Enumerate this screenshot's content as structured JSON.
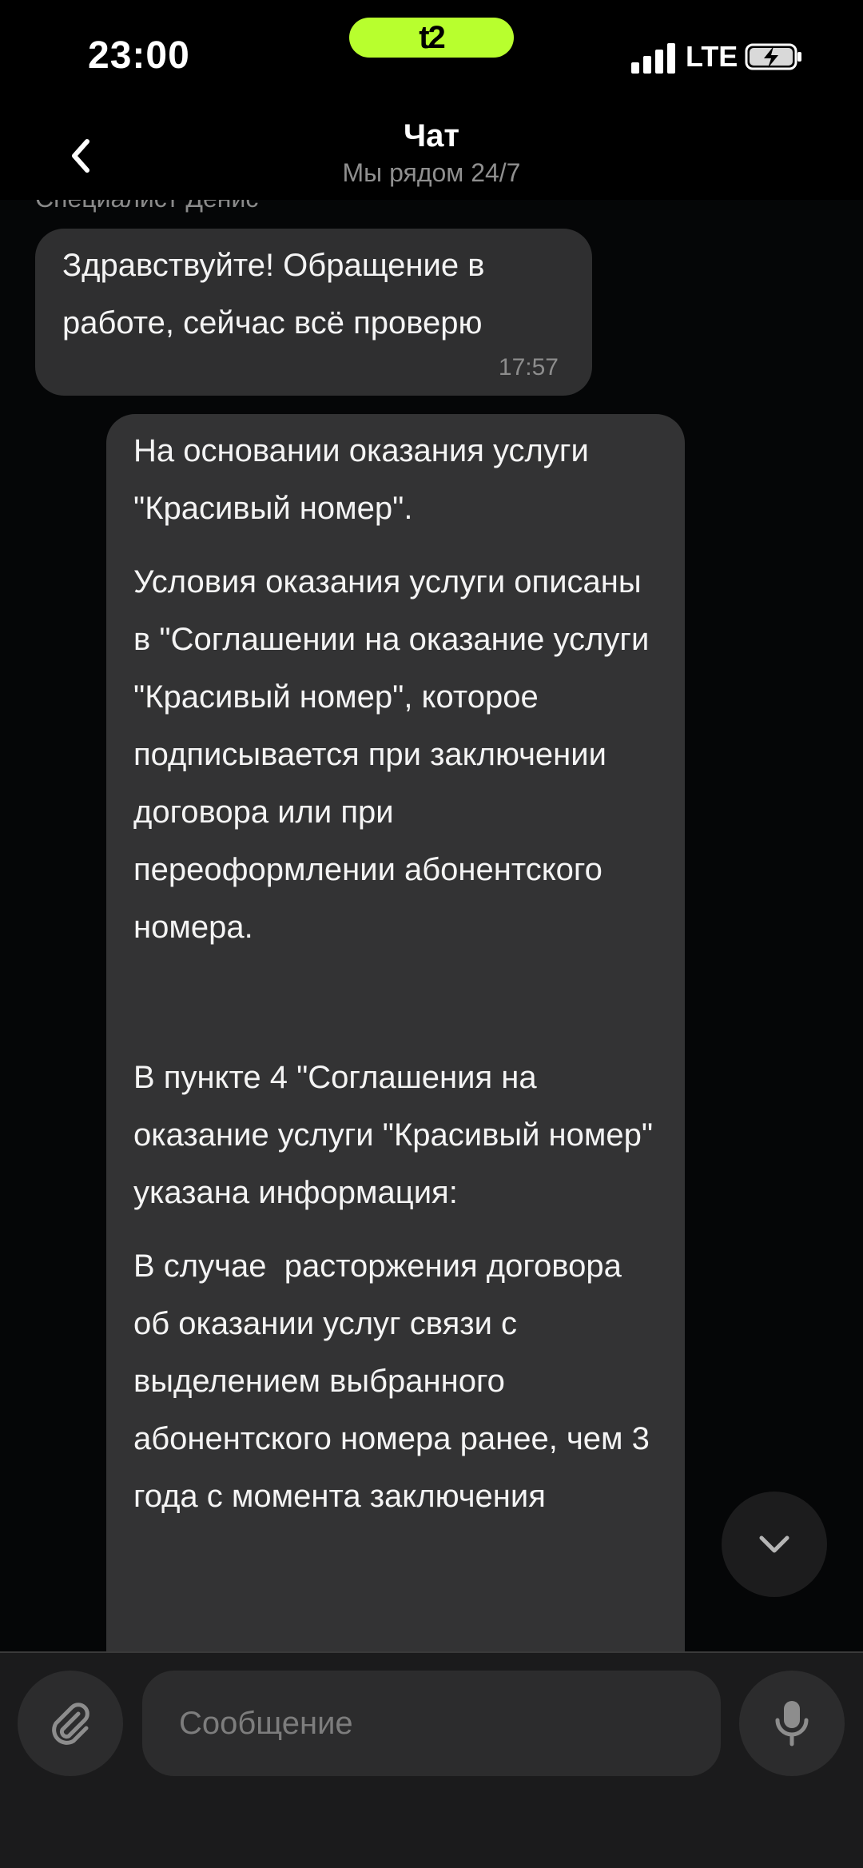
{
  "status_bar": {
    "time": "23:00",
    "carrier": "t2",
    "network": "LTE"
  },
  "header": {
    "title": "Чат",
    "subtitle": "Мы рядом 24/7"
  },
  "messages": [
    {
      "sender": "Специалист Денис",
      "text": "Здравствуйте! Обращение в работе, сейчас всё проверю",
      "time": "17:57"
    },
    {
      "paragraphs": [
        "На основании оказания услуги \"Красивый номер\".",
        "Условия оказания услуги описаны в \"Соглашении на оказание услуги \"Красивый номер\", которое подписывается при заключении договора или при переоформлении абонентского номера.",
        "В пункте 4 \"Соглашения на оказание услуги \"Красивый номер\" указана информация:",
        "В случае  расторжения договора об оказании услуг связи с выделением выбранного  абонентского номера ранее, чем 3 года с момента заключения"
      ]
    }
  ],
  "composer": {
    "placeholder": "Сообщение"
  },
  "icons": {
    "back": "chevron-left-icon",
    "scroll_down": "chevron-down-icon",
    "attach": "paperclip-icon",
    "mic": "microphone-icon"
  },
  "colors": {
    "carrier_accent": "#b8ff2e",
    "bubble": "#2f2f30",
    "background": "#050607"
  }
}
